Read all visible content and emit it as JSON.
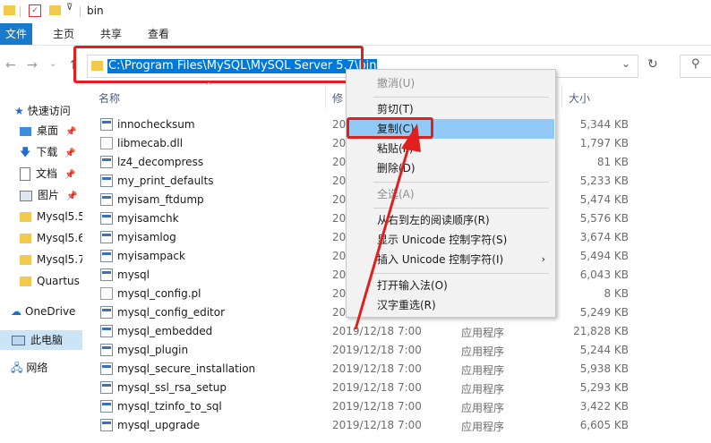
{
  "titlebar": {
    "title": "bin"
  },
  "ribbon": {
    "tabs": [
      {
        "label": "文件",
        "active": true
      },
      {
        "label": "主页",
        "active": false
      },
      {
        "label": "共享",
        "active": false
      },
      {
        "label": "查看",
        "active": false
      }
    ]
  },
  "address": {
    "path": "C:\\Program Files\\MySQL\\MySQL Server 5.7\\bin"
  },
  "navpane": {
    "items": [
      {
        "label": "快速访问"
      },
      {
        "label": "桌面"
      },
      {
        "label": "下载"
      },
      {
        "label": "文档"
      },
      {
        "label": "图片"
      },
      {
        "label": "Mysql5.5"
      },
      {
        "label": "Mysql5.6"
      },
      {
        "label": "Mysql5.7"
      },
      {
        "label": "Quartus"
      },
      {
        "label": "OneDrive"
      },
      {
        "label": "此电脑"
      },
      {
        "label": "网络"
      }
    ]
  },
  "columns": {
    "name": "名称",
    "date": "修",
    "size": "大小"
  },
  "files": [
    {
      "name": "innochecksum",
      "date": "20",
      "type": "",
      "size": "5,344 KB"
    },
    {
      "name": "libmecab.dll",
      "date": "20",
      "type": "",
      "size": "1,797 KB"
    },
    {
      "name": "lz4_decompress",
      "date": "20",
      "type": "",
      "size": "81 KB"
    },
    {
      "name": "my_print_defaults",
      "date": "20",
      "type": "",
      "size": "5,233 KB"
    },
    {
      "name": "myisam_ftdump",
      "date": "20",
      "type": "",
      "size": "5,474 KB"
    },
    {
      "name": "myisamchk",
      "date": "20",
      "type": "",
      "size": "5,576 KB"
    },
    {
      "name": "myisamlog",
      "date": "20",
      "type": "",
      "size": "3,674 KB"
    },
    {
      "name": "myisampack",
      "date": "20",
      "type": "",
      "size": "5,494 KB"
    },
    {
      "name": "mysql",
      "date": "20",
      "type": "",
      "size": "6,043 KB"
    },
    {
      "name": "mysql_config.pl",
      "date": "20",
      "type": "",
      "size": "8 KB"
    },
    {
      "name": "mysql_config_editor",
      "date": "20",
      "type": "",
      "size": "5,249 KB"
    },
    {
      "name": "mysql_embedded",
      "date": "2019/12/18 7:00",
      "type": "应用程序",
      "size": "21,828 KB"
    },
    {
      "name": "mysql_plugin",
      "date": "2019/12/18 7:00",
      "type": "应用程序",
      "size": "5,244 KB"
    },
    {
      "name": "mysql_secure_installation",
      "date": "2019/12/18 7:00",
      "type": "应用程序",
      "size": "5,938 KB"
    },
    {
      "name": "mysql_ssl_rsa_setup",
      "date": "2019/12/18 7:00",
      "type": "应用程序",
      "size": "5,293 KB"
    },
    {
      "name": "mysql_tzinfo_to_sql",
      "date": "2019/12/18 7:00",
      "type": "应用程序",
      "size": "3,422 KB"
    },
    {
      "name": "mysql_upgrade",
      "date": "2019/12/18 7:00",
      "type": "应用程序",
      "size": "6,605 KB"
    }
  ],
  "contextmenu": {
    "items": [
      {
        "label": "撤消(U)",
        "disabled": true
      },
      {
        "label": "剪切(T)",
        "disabled": false
      },
      {
        "label": "复制(C)",
        "disabled": false,
        "highlighted": true
      },
      {
        "label": "粘贴(P)",
        "disabled": false
      },
      {
        "label": "删除(D)",
        "disabled": false
      },
      {
        "label": "全选(A)",
        "disabled": true
      },
      {
        "label": "从右到左的阅读顺序(R)",
        "disabled": false
      },
      {
        "label": "显示 Unicode 控制字符(S)",
        "disabled": false
      },
      {
        "label": "插入 Unicode 控制字符(I)",
        "disabled": false,
        "submenu": true
      },
      {
        "label": "打开输入法(O)",
        "disabled": false
      },
      {
        "label": "汉字重选(R)",
        "disabled": false
      }
    ]
  },
  "colors": {
    "accent": "#0078d7",
    "highlight_red": "#e0201e",
    "menu_hover": "#91c9f7"
  }
}
